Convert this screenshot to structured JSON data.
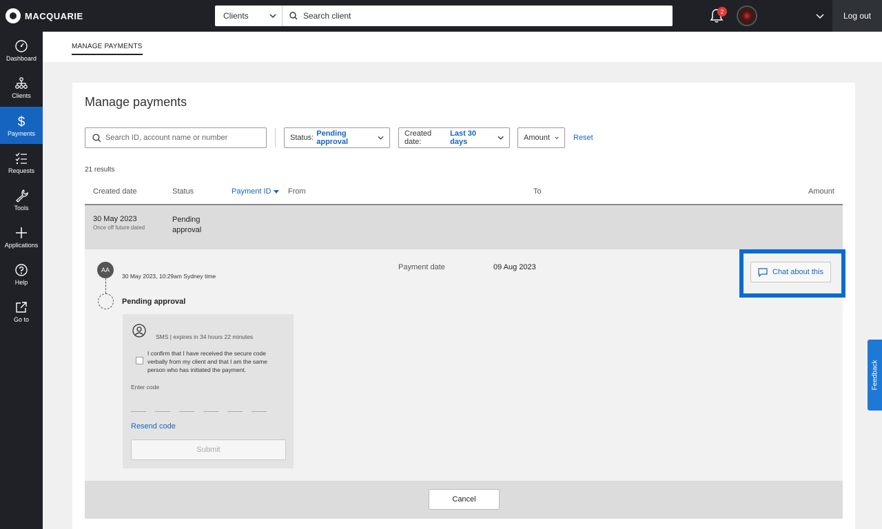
{
  "brand": {
    "name": "MACQUARIE"
  },
  "topbar": {
    "search_scope": "Clients",
    "search_placeholder": "Search client",
    "notification_count": "2",
    "logout_label": "Log out"
  },
  "nav": {
    "items": [
      {
        "label": "Dashboard",
        "icon": "dashboard-icon"
      },
      {
        "label": "Clients",
        "icon": "clients-icon"
      },
      {
        "label": "Payments",
        "icon": "dollar-icon",
        "active": true
      },
      {
        "label": "Requests",
        "icon": "list-icon"
      },
      {
        "label": "Tools",
        "icon": "wrench-icon"
      },
      {
        "label": "Applications",
        "icon": "plus-icon"
      },
      {
        "label": "Help",
        "icon": "help-icon"
      },
      {
        "label": "Go to",
        "icon": "external-link-icon"
      }
    ]
  },
  "tabs": {
    "active": "MANAGE PAYMENTS"
  },
  "page": {
    "title": "Manage payments",
    "search_placeholder": "Search ID, account name or number",
    "filters": {
      "status_label": "Status:",
      "status_value": "Pending approval",
      "created_label": "Created date:",
      "created_value": "Last 30 days",
      "amount_label": "Amount",
      "reset_label": "Reset"
    },
    "results_count": "21 results",
    "columns": {
      "created": "Created date",
      "status": "Status",
      "payment_id": "Payment ID",
      "from": "From",
      "to": "To",
      "amount": "Amount"
    },
    "row": {
      "created_date": "30 May 2023",
      "created_sub": "Once off future dated",
      "status": "Pending approval"
    },
    "detail": {
      "avatar_initials": "AA",
      "timestamp": "30 May 2023, 10:29am Sydney time",
      "pending_title": "Pending approval",
      "payment_date_label": "Payment date",
      "payment_date_value": "09 Aug 2023",
      "chat_label": "Chat about this",
      "verify": {
        "sms_text": "SMS | expires in 34 hours 22 minutes",
        "confirm_text": "I confirm that I have received the secure code verbally from my client and that I am the same person who has initiated the payment.",
        "enter_code_label": "Enter code",
        "resend_label": "Resend code",
        "submit_label": "Submit"
      }
    },
    "cancel_label": "Cancel"
  },
  "feedback_label": "Feedback",
  "colors": {
    "accent": "#1565c0",
    "highlight": "#0a6ad8",
    "nav_bg": "#1f2126"
  }
}
